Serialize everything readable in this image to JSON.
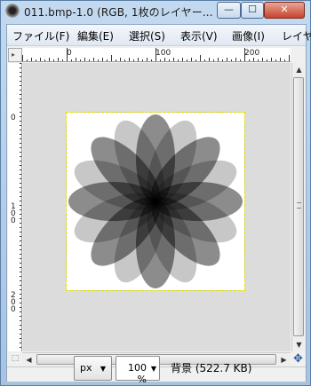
{
  "window": {
    "title": "011.bmp-1.0 (RGB, 1枚のレイヤー...",
    "min_glyph": "—",
    "max_glyph": "☐",
    "close_glyph": "✕"
  },
  "menubar": {
    "items": [
      {
        "label": "ファイル(F)"
      },
      {
        "label": "編集(E)"
      },
      {
        "label": "選択(S)"
      },
      {
        "label": "表示(V)"
      },
      {
        "label": "画像(I)"
      },
      {
        "label": "レイヤ"
      }
    ]
  },
  "ruler": {
    "corner_glyph": "▸",
    "top_labels": [
      "0",
      "100",
      "200"
    ],
    "left_labels": [
      "0",
      "100",
      "200"
    ]
  },
  "scrollbars": {
    "up_glyph": "▲",
    "down_glyph": "▼",
    "left_glyph": "◀",
    "right_glyph": "▶"
  },
  "corner": {
    "quickmask_glyph": "⬚",
    "navigate_glyph": "✥"
  },
  "status": {
    "unit": "px",
    "unit_dd": "▼",
    "zoom": "100 %",
    "zoom_dd": "▼",
    "text": "背景 (522.7 KB)"
  },
  "image": {
    "petal_colors": [
      "#000000"
    ],
    "background": "#ffffff"
  }
}
